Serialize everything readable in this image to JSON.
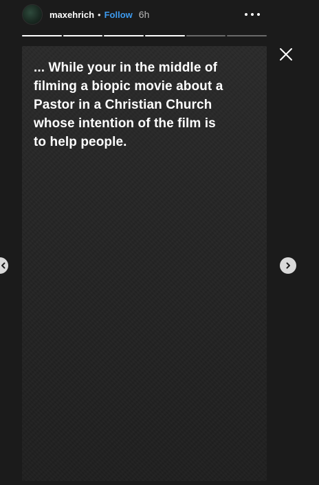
{
  "header": {
    "username": "maxehrich",
    "separator": "•",
    "follow_label": "Follow",
    "time": "6h"
  },
  "progress": {
    "segments": [
      1,
      1,
      1,
      1,
      0,
      0
    ],
    "active_color": "#ffffff",
    "inactive_color": "rgba(255,255,255,0.35)"
  },
  "story": {
    "lines": [
      "... While your in the middle of",
      "filming a biopic movie about a",
      "Pastor in a Christian Church",
      "whose intention of the film is",
      "to help people."
    ]
  },
  "icons": {
    "more": "more-options-icon",
    "close": "close-icon",
    "prev": "chevron-left-icon",
    "next": "chevron-right-icon"
  },
  "colors": {
    "background": "#1b1b1b",
    "follow": "#3d9bf0",
    "text": "#ffffff"
  }
}
